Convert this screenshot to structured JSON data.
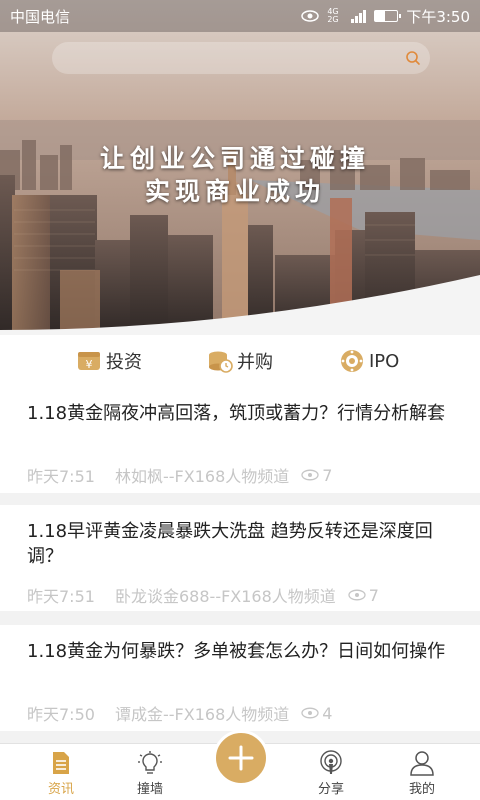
{
  "status_bar": {
    "carrier": "中国电信",
    "network": "4G 2G",
    "time": "下午3:50"
  },
  "search": {
    "placeholder": ""
  },
  "banner": {
    "line1": "让创业公司通过碰撞",
    "line2": "实现商业成功"
  },
  "categories": [
    {
      "label": "投资",
      "icon": "invest-icon"
    },
    {
      "label": "并购",
      "icon": "merger-icon"
    },
    {
      "label": "IPO",
      "icon": "ipo-icon"
    }
  ],
  "news": [
    {
      "title": "1.18黄金隔夜冲高回落，筑顶或蓄力？行情分析解套",
      "time": "昨天7:51",
      "author": "林如枫--FX168人物频道",
      "views": "7"
    },
    {
      "title": "1.18早评黄金凌晨暴跌大洗盘 趋势反转还是深度回调？",
      "time": "昨天7:51",
      "author": "卧龙谈金688--FX168人物频道",
      "views": "7"
    },
    {
      "title": "1.18黄金为何暴跌？多单被套怎么办？日间如何操作",
      "time": "昨天7:50",
      "author": "谭成金--FX168人物频道",
      "views": "4"
    }
  ],
  "nav": [
    {
      "label": "资讯",
      "active": true
    },
    {
      "label": "撞墙"
    },
    {
      "label": "分享"
    },
    {
      "label": "我的"
    }
  ],
  "colors": {
    "accent": "#d8a448",
    "fab": "#d9ac63"
  }
}
